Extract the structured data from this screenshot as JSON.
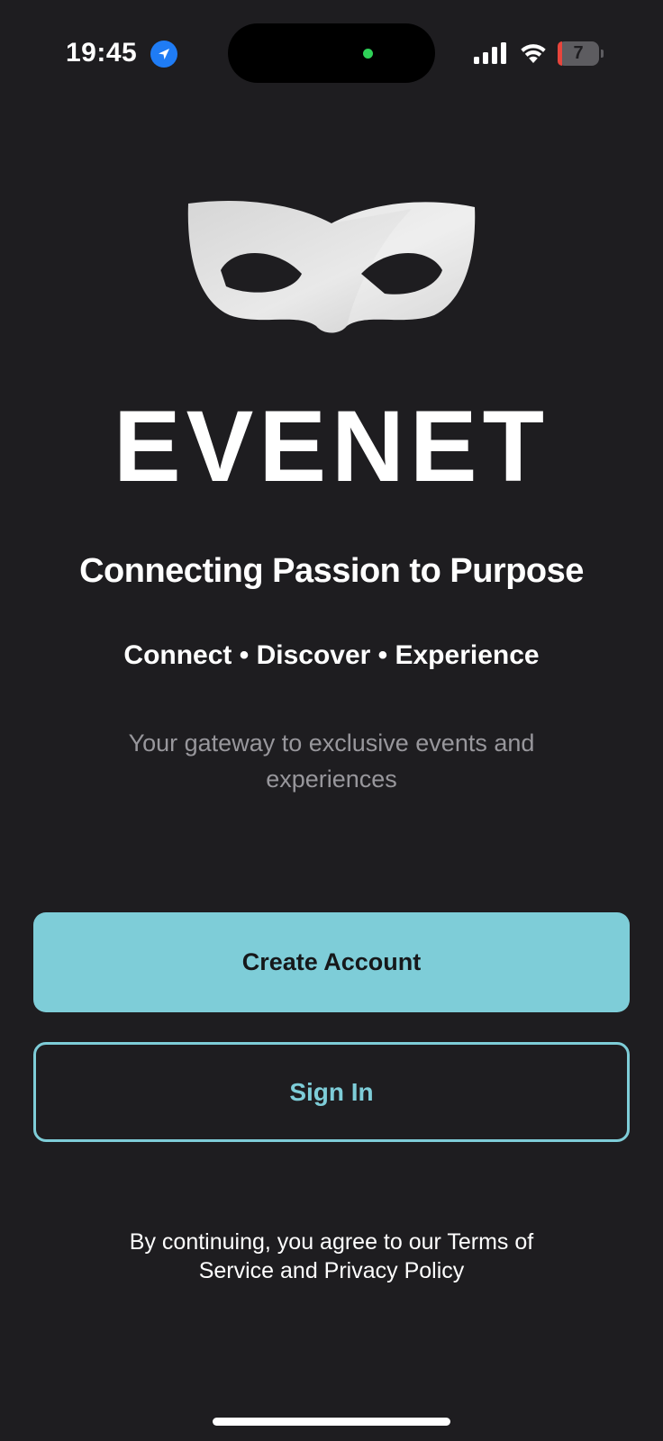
{
  "status_bar": {
    "time": "19:45",
    "battery_level": "7",
    "location_icon": "location-arrow-icon",
    "signal_icon": "cellular-signal-icon",
    "wifi_icon": "wifi-icon",
    "battery_icon": "battery-icon"
  },
  "logo": {
    "icon": "masquerade-mask-icon",
    "brand_name": "EVENET"
  },
  "tagline": "Connecting Passion to Purpose",
  "subtagline": "Connect • Discover • Experience",
  "description": "Your gateway to exclusive events and experiences",
  "actions": {
    "create_account_label": "Create Account",
    "sign_in_label": "Sign In"
  },
  "legal_text": "By continuing, you agree to our Terms of Service and Privacy Policy",
  "colors": {
    "background": "#1e1d20",
    "accent": "#7ecdd8",
    "muted_text": "#98979c",
    "battery_low": "#e8453c",
    "location_blue": "#1f7cf5"
  }
}
